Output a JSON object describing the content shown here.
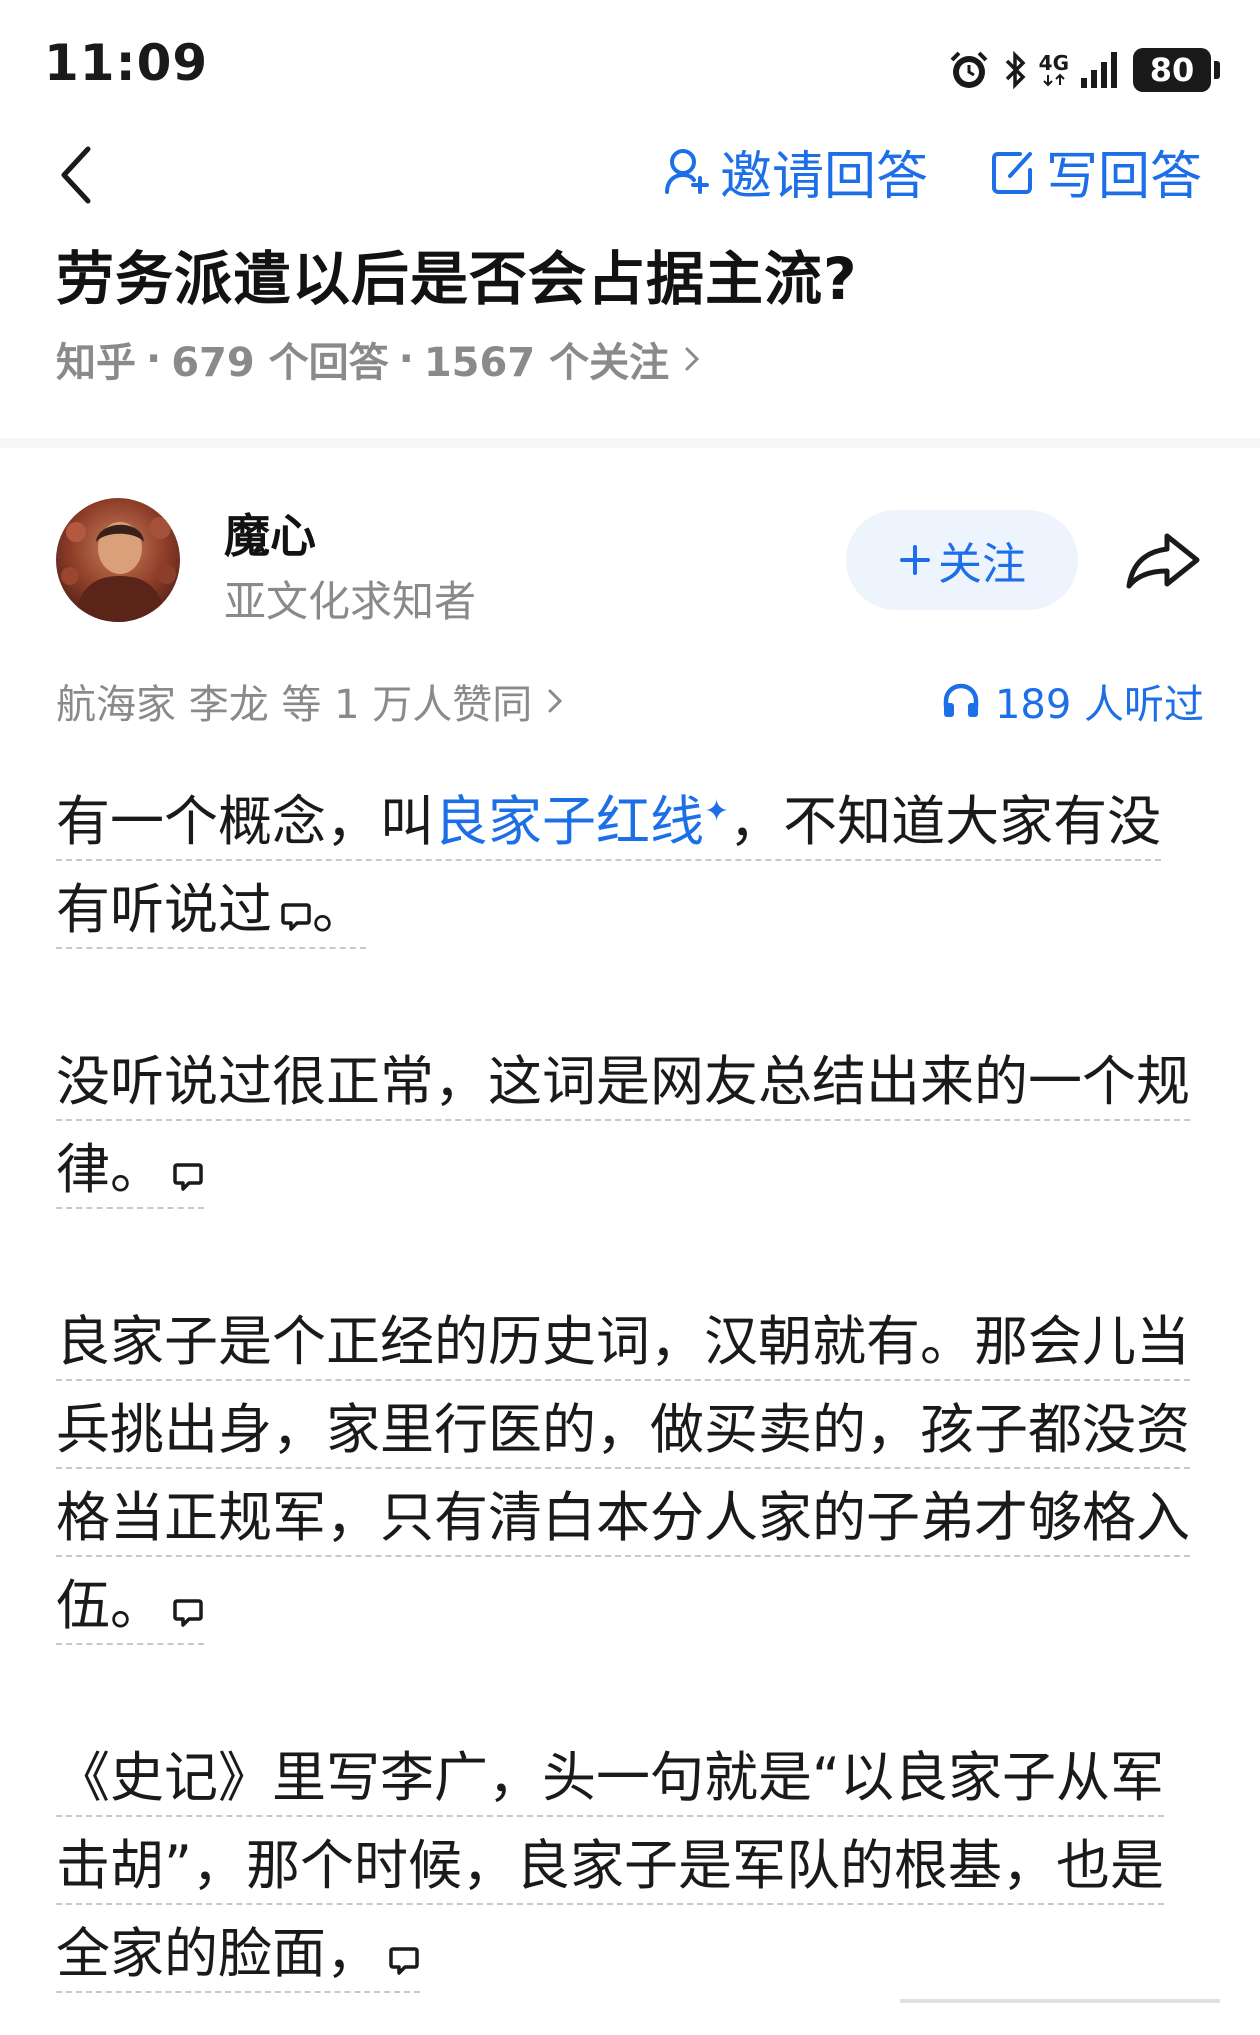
{
  "status": {
    "time": "11:09",
    "network": "4G",
    "battery": "80"
  },
  "nav": {
    "invite_label": "邀请回答",
    "write_label": "写回答"
  },
  "question": {
    "title": "劳务派遣以后是否会占据主流?",
    "source": "知乎",
    "answers": "679 个回答",
    "followers": "1567 个关注"
  },
  "author": {
    "name": "魔心",
    "bio": "亚文化求知者",
    "follow_label": "关注"
  },
  "stats": {
    "upvote_text": "航海家 李龙 等 1 万人赞同",
    "listen_text": "189 人听过"
  },
  "answer": {
    "p1_a": "有一个概念，叫",
    "p1_link": "良家子红线",
    "p1_b": "，不知道大家有没有听说过",
    "p1_c": "。",
    "p2": "没听说过很正常，这词是网友总结出来的一个规律。",
    "p3": "良家子是个正经的历史词，汉朝就有。那会儿当兵挑出身，家里行医的，做买卖的，孩子都没资格当正规军，只有清白本分人家的子弟才够格入伍。",
    "p4": "《史记》里写李广，头一句就是“以良家子从军击胡”，那个时候，良家子是军队的根基，也是全家的脸面，"
  },
  "colors": {
    "accent": "#1d6fe8",
    "meta_gray": "#8a8a8a",
    "follow_bg": "#eef4fd"
  },
  "icons": [
    "back-icon",
    "invite-icon",
    "edit-icon",
    "share-icon",
    "headphone-icon",
    "comment-icon",
    "chevron-right-icon"
  ]
}
